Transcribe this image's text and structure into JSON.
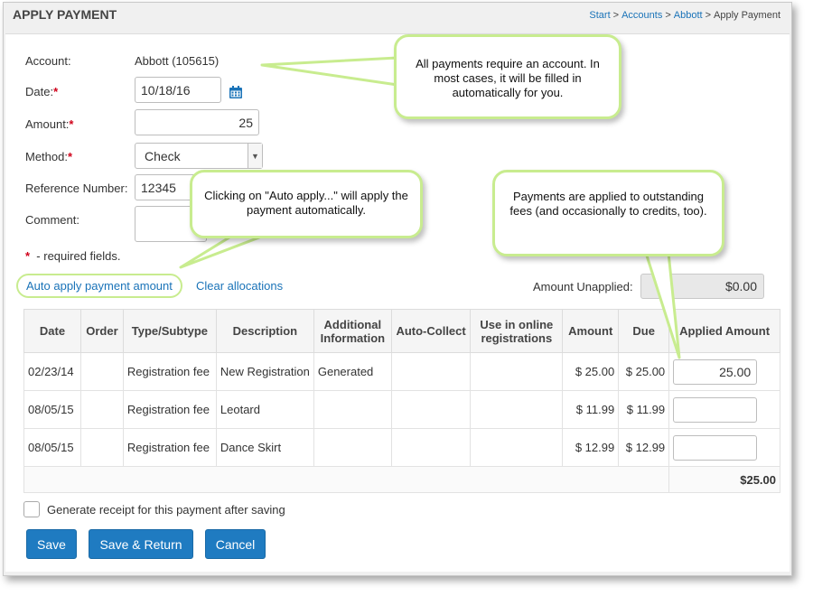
{
  "header": {
    "title": "APPLY PAYMENT",
    "breadcrumb": [
      "Start",
      "Accounts",
      "Abbott",
      "Apply Payment"
    ],
    "breadcrumb_sep": ">"
  },
  "form": {
    "account_label": "Account:",
    "account_value": "Abbott (105615)",
    "date_label": "Date:",
    "date_value": "10/18/16",
    "amount_label": "Amount:",
    "amount_value": "25",
    "method_label": "Method:",
    "method_value": "Check",
    "reference_label": "Reference Number:",
    "reference_value": "12345",
    "comment_label": "Comment:",
    "comment_value": "",
    "required_star": "*",
    "required_note": "- required fields."
  },
  "actions": {
    "auto_apply": "Auto apply payment amount",
    "clear_allocations": "Clear allocations",
    "amount_unapplied_label": "Amount Unapplied:",
    "amount_unapplied_value": "$0.00"
  },
  "table": {
    "headers": [
      "Date",
      "Order",
      "Type/Subtype",
      "Description",
      "Additional Information",
      "Auto-Collect",
      "Use in online registrations",
      "Amount",
      "Due",
      "Applied Amount"
    ],
    "rows": [
      {
        "date": "02/23/14",
        "order": "",
        "type": "Registration fee",
        "description": "New Registration",
        "additional": "Generated",
        "auto_collect": "",
        "online": "",
        "amount": "$ 25.00",
        "due": "$ 25.00",
        "applied": "25.00"
      },
      {
        "date": "08/05/15",
        "order": "",
        "type": "Registration fee",
        "description": "Leotard",
        "additional": "",
        "auto_collect": "",
        "online": "",
        "amount": "$ 11.99",
        "due": "$ 11.99",
        "applied": ""
      },
      {
        "date": "08/05/15",
        "order": "",
        "type": "Registration fee",
        "description": "Dance Skirt",
        "additional": "",
        "auto_collect": "",
        "online": "",
        "amount": "$ 12.99",
        "due": "$ 12.99",
        "applied": ""
      }
    ],
    "total": "$25.00"
  },
  "receipt_label": "Generate receipt for this payment after saving",
  "buttons": {
    "save": "Save",
    "save_return": "Save & Return",
    "cancel": "Cancel"
  },
  "callouts": {
    "account": "All payments require an account. In most cases, it will be filled in automatically for you.",
    "auto_apply": "Clicking on \"Auto apply...\" will apply the payment automatically.",
    "applied": "Payments are applied to outstanding fees (and occasionally to credits, too)."
  },
  "colors": {
    "accent": "#1f7bc1",
    "link": "#1a73b8",
    "required": "#d0021b",
    "callout_border": "#c8ec8f"
  }
}
